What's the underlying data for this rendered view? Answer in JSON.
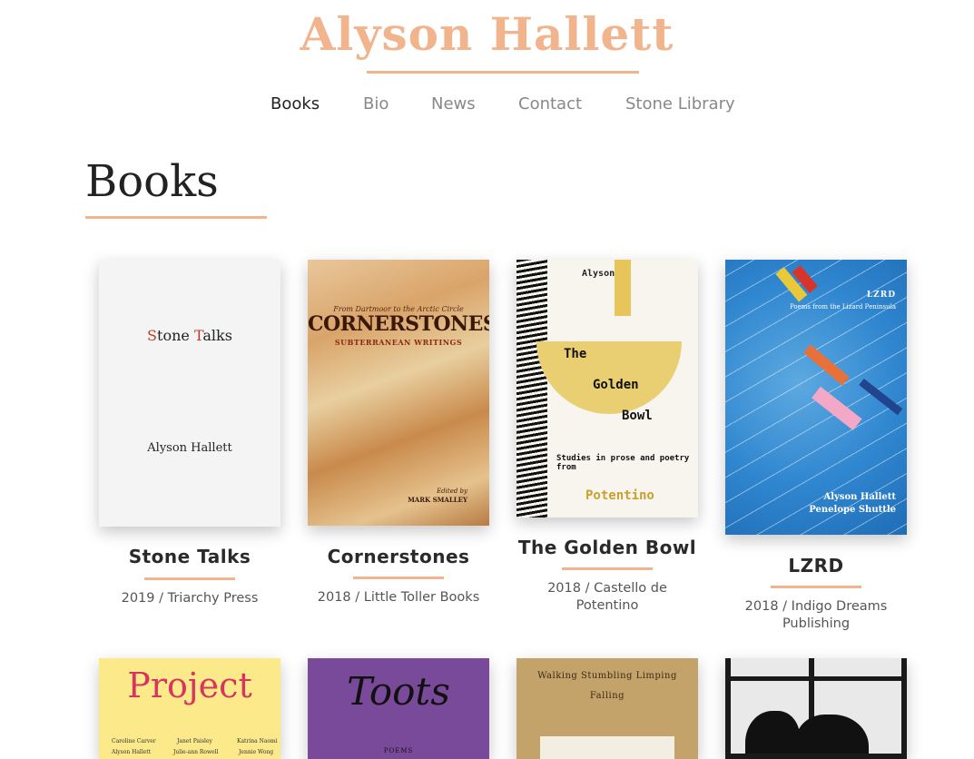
{
  "site": {
    "title": "Alyson Hallett"
  },
  "nav": {
    "items": [
      "Books",
      "Bio",
      "News",
      "Contact",
      "Stone Library"
    ]
  },
  "page": {
    "heading": "Books"
  },
  "colors": {
    "accent": "#f2b48c",
    "text": "#222222",
    "muted": "#888888"
  },
  "books": [
    {
      "title": "Stone Talks",
      "meta": "2019 / Triarchy Press",
      "cover": {
        "title_first": "S",
        "title_a": "tone ",
        "title_second": "T",
        "title_b": "alks",
        "author": "Alyson Hallett"
      }
    },
    {
      "title": "Cornerstones",
      "meta": "2018 / Little Toller Books",
      "cover": {
        "kicker": "From Dartmoor to the Arctic Circle",
        "title": "CORNERSTONES",
        "subtitle": "SUBTERRANEAN WRITINGS",
        "editor_label": "Edited by",
        "editor": "MARK SMALLEY"
      }
    },
    {
      "title": "The Golden Bowl",
      "meta_line1": "2018 / Castello de",
      "meta_line2": "Potentino",
      "cover": {
        "author": "Alyson",
        "w1": "The",
        "w2": "Golden",
        "w3": "Bowl",
        "w4": "Studies in prose and poetry from",
        "w5": "Potentino"
      }
    },
    {
      "title": "LZRD",
      "meta_line1": "2018 / Indigo Dreams",
      "meta_line2": "Publishing",
      "cover": {
        "title": "LZRD",
        "subtitle": "Poems from the Lizard Peninsula",
        "author1": "Alyson Hallett",
        "author2": "Penelope Shuttle"
      }
    }
  ],
  "books_row2": [
    {
      "cover": {
        "title": "Project",
        "names": [
          "Caroline Carver",
          "Janet Paisley",
          "Katrina Naomi",
          "Alyson Hallett",
          "Julie-ann Rowell",
          "Jennie Wong"
        ]
      }
    },
    {
      "cover": {
        "title": "Toots",
        "subtitle": "POEMS"
      }
    },
    {
      "cover": {
        "line1": "Walking Stumbling Limping",
        "line2": "Falling"
      }
    },
    {
      "cover": {}
    }
  ]
}
